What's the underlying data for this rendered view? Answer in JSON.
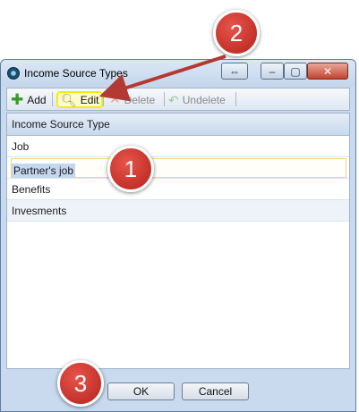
{
  "window": {
    "title": "Income Source Types"
  },
  "title_buttons": {
    "restore_size": "⇔",
    "minimize": "–",
    "maximize": "▢",
    "close": "✕"
  },
  "toolbar": {
    "add_label": "Add",
    "edit_label": "Edit",
    "delete_label": "Delete",
    "undelete_label": "Undelete",
    "icons": {
      "add": "plus-icon",
      "edit": "magnifier-icon",
      "delete": "x-icon",
      "undelete": "undo-arrow-icon"
    }
  },
  "grid": {
    "header": "Income Source Type",
    "rows": [
      {
        "value": "Job"
      },
      {
        "value": "Partner's job"
      },
      {
        "value": "Benefits"
      },
      {
        "value": "Invesments"
      }
    ]
  },
  "footer": {
    "ok_label": "OK",
    "cancel_label": "Cancel"
  },
  "callouts": {
    "one": "1",
    "two": "2",
    "three": "3"
  },
  "colors": {
    "callout": "#c62a22",
    "highlight": "#f2ec16",
    "selection": "#c4d7ee"
  }
}
